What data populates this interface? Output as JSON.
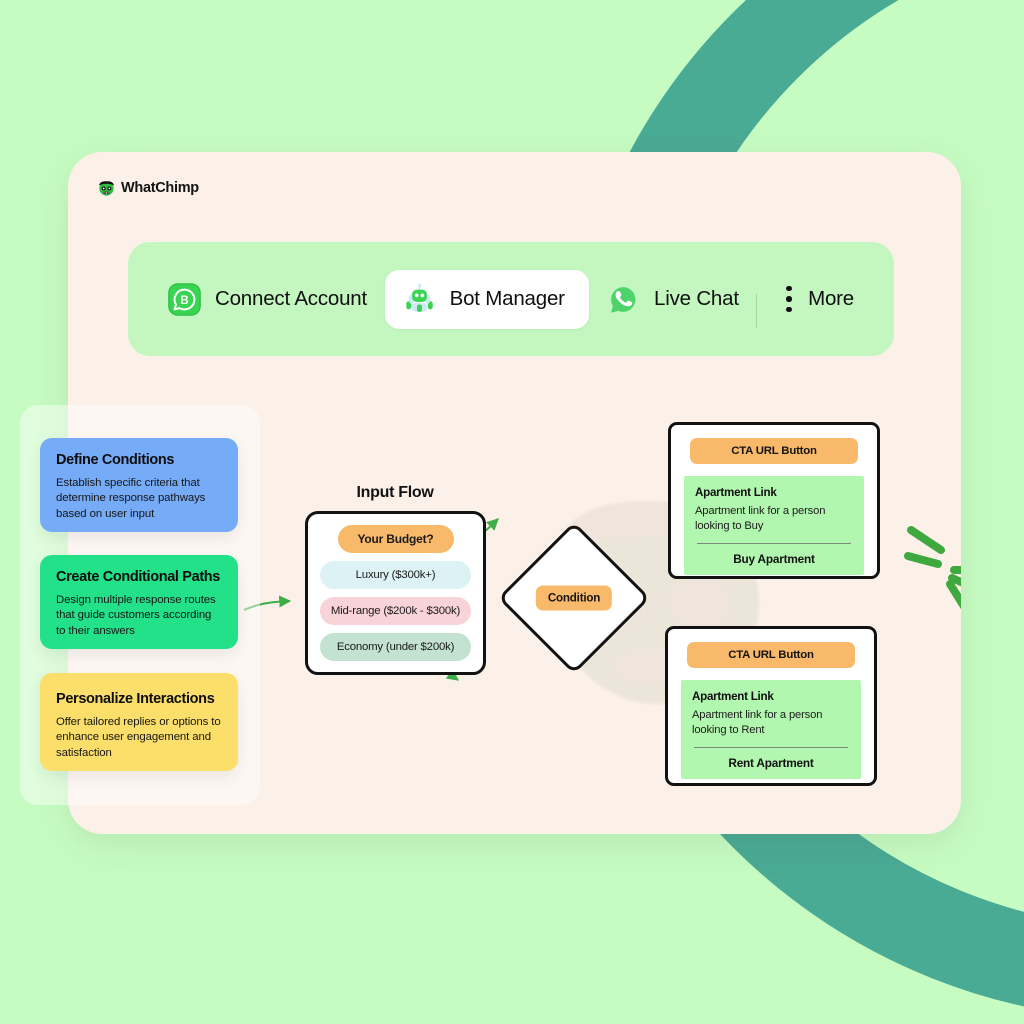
{
  "theme": {
    "page_bg": "#c6fcc2",
    "ring_color": "#4aab95",
    "card_bg": "#fcf1e9",
    "nav_bg": "#c4f6c0",
    "accent_orange": "#f9b96b",
    "accent_green": "#b2f7b0",
    "connector_green": "#3fae4a"
  },
  "brand": {
    "name": "WhatChimp",
    "logo_icon": "chimp-logo-icon"
  },
  "nav": {
    "items": [
      {
        "id": "connect-account",
        "label": "Connect Account",
        "icon": "whatsapp-business-icon",
        "active": false
      },
      {
        "id": "bot-manager",
        "label": "Bot Manager",
        "icon": "robot-icon",
        "active": true
      },
      {
        "id": "live-chat",
        "label": "Live Chat",
        "icon": "whatsapp-phone-icon",
        "active": false
      },
      {
        "id": "more",
        "label": "More",
        "icon": "three-dots-vertical-icon",
        "active": false
      }
    ]
  },
  "features": [
    {
      "title": "Define Conditions",
      "body": "Establish specific criteria that determine response pathways based on user input",
      "color": "#76abf7"
    },
    {
      "title": "Create Conditional Paths",
      "body": "Design multiple response routes that guide customers according to their answers",
      "color": "#22e189"
    },
    {
      "title": "Personalize Interactions",
      "body": "Offer tailored replies or options to enhance user engagement and satisfaction",
      "color": "#fbdf6a"
    }
  ],
  "flow": {
    "input_node": {
      "title": "Input Flow",
      "question": "Your Budget?",
      "options": [
        {
          "label": "Luxury ($300k+)",
          "color": "#dcf2f5"
        },
        {
          "label": "Mid-range ($200k - $300k)",
          "color": "#f8d3d8"
        },
        {
          "label": "Economy (under $200k)",
          "color": "#c3e2d2"
        }
      ]
    },
    "condition_node": {
      "label": "Condition"
    },
    "cta_cards": [
      {
        "header": "CTA URL Button",
        "title": "Apartment Link",
        "description": "Apartment link for a person looking to Buy",
        "action": "Buy Apartment"
      },
      {
        "header": "CTA URL Button",
        "title": "Apartment Link",
        "description": "Apartment link for a person looking to Rent",
        "action": "Rent Apartment"
      }
    ]
  }
}
